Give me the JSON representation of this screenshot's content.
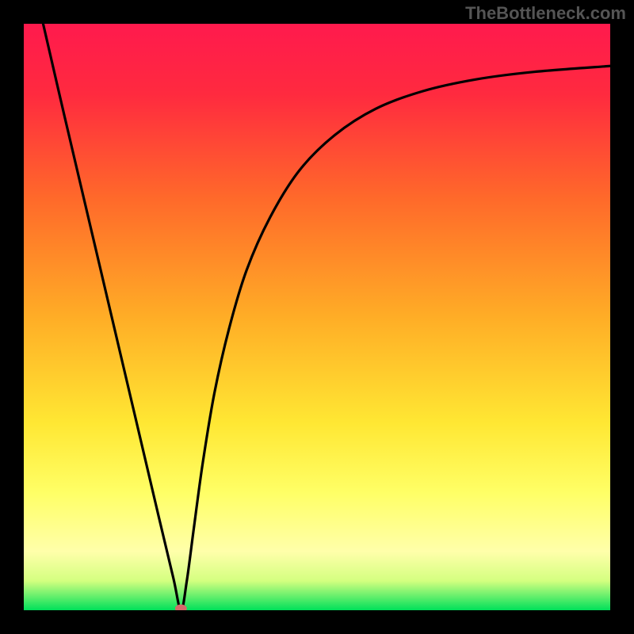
{
  "watermark": "TheBottleneck.com",
  "chart_data": {
    "type": "line",
    "title": "",
    "xlabel": "",
    "ylabel": "",
    "xlim": [
      0,
      1
    ],
    "ylim": [
      0,
      1
    ],
    "gradient_stops": [
      {
        "offset": 0.0,
        "color": "#ff1a4d"
      },
      {
        "offset": 0.12,
        "color": "#ff2a3f"
      },
      {
        "offset": 0.3,
        "color": "#ff6a2a"
      },
      {
        "offset": 0.5,
        "color": "#ffad26"
      },
      {
        "offset": 0.68,
        "color": "#ffe733"
      },
      {
        "offset": 0.8,
        "color": "#ffff66"
      },
      {
        "offset": 0.9,
        "color": "#ffffaa"
      },
      {
        "offset": 0.95,
        "color": "#d4ff80"
      },
      {
        "offset": 1.0,
        "color": "#00e05a"
      }
    ],
    "asymptote_y": 0.107,
    "marker": {
      "x": 0.268,
      "y": 0.003,
      "color": "#d46a6a",
      "rx": 0.01,
      "ry": 0.007
    },
    "series": [
      {
        "name": "curve",
        "color": "#000000",
        "points": [
          {
            "x": 0.033,
            "y": 1.0
          },
          {
            "x": 0.07,
            "y": 0.84
          },
          {
            "x": 0.11,
            "y": 0.67
          },
          {
            "x": 0.15,
            "y": 0.5
          },
          {
            "x": 0.19,
            "y": 0.33
          },
          {
            "x": 0.23,
            "y": 0.16
          },
          {
            "x": 0.255,
            "y": 0.055
          },
          {
            "x": 0.268,
            "y": 0.0
          },
          {
            "x": 0.278,
            "y": 0.05
          },
          {
            "x": 0.29,
            "y": 0.14
          },
          {
            "x": 0.305,
            "y": 0.25
          },
          {
            "x": 0.325,
            "y": 0.37
          },
          {
            "x": 0.35,
            "y": 0.48
          },
          {
            "x": 0.38,
            "y": 0.58
          },
          {
            "x": 0.42,
            "y": 0.67
          },
          {
            "x": 0.47,
            "y": 0.75
          },
          {
            "x": 0.53,
            "y": 0.81
          },
          {
            "x": 0.6,
            "y": 0.855
          },
          {
            "x": 0.68,
            "y": 0.885
          },
          {
            "x": 0.77,
            "y": 0.905
          },
          {
            "x": 0.87,
            "y": 0.918
          },
          {
            "x": 1.0,
            "y": 0.928
          }
        ]
      }
    ]
  }
}
